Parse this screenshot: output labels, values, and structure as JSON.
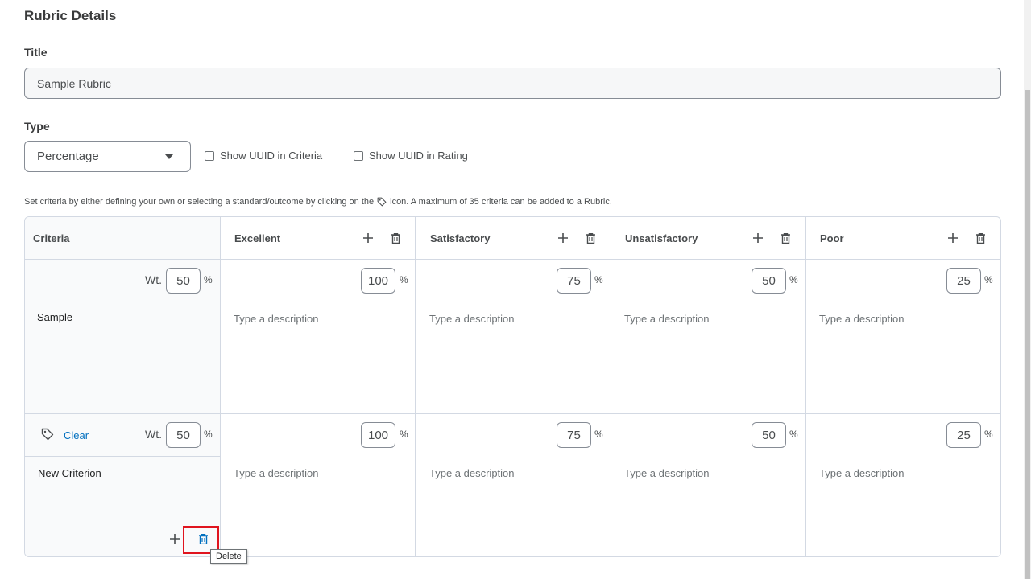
{
  "section_title": "Rubric Details",
  "title_field": {
    "label": "Title",
    "value": "Sample Rubric"
  },
  "type_field": {
    "label": "Type",
    "selected": "Percentage"
  },
  "checkboxes": [
    {
      "label": "Show UUID in Criteria",
      "checked": false
    },
    {
      "label": "Show UUID in Rating",
      "checked": false
    }
  ],
  "helper": {
    "before_icon": "Set criteria by either defining your own or selecting a standard/outcome by clicking on the",
    "icon": "tag-icon",
    "after_icon": "icon. A maximum of 35 criteria can be added to a Rubric."
  },
  "table": {
    "criteria_header": "Criteria",
    "levels": [
      "Excellent",
      "Satisfactory",
      "Unsatisfactory",
      "Poor"
    ],
    "wt_label": "Wt.",
    "percent_sign": "%",
    "desc_placeholder": "Type a description",
    "rows": [
      {
        "name": "Sample",
        "weight": "50",
        "level_values": [
          "100",
          "75",
          "50",
          "25"
        ]
      },
      {
        "name": "New Criterion",
        "weight": "50",
        "clear_label": "Clear",
        "level_values": [
          "100",
          "75",
          "50",
          "25"
        ]
      }
    ]
  },
  "tooltip": "Delete",
  "colors": {
    "accent": "#006fbf",
    "highlight": "#e0141e",
    "border": "#d3d9e3"
  }
}
